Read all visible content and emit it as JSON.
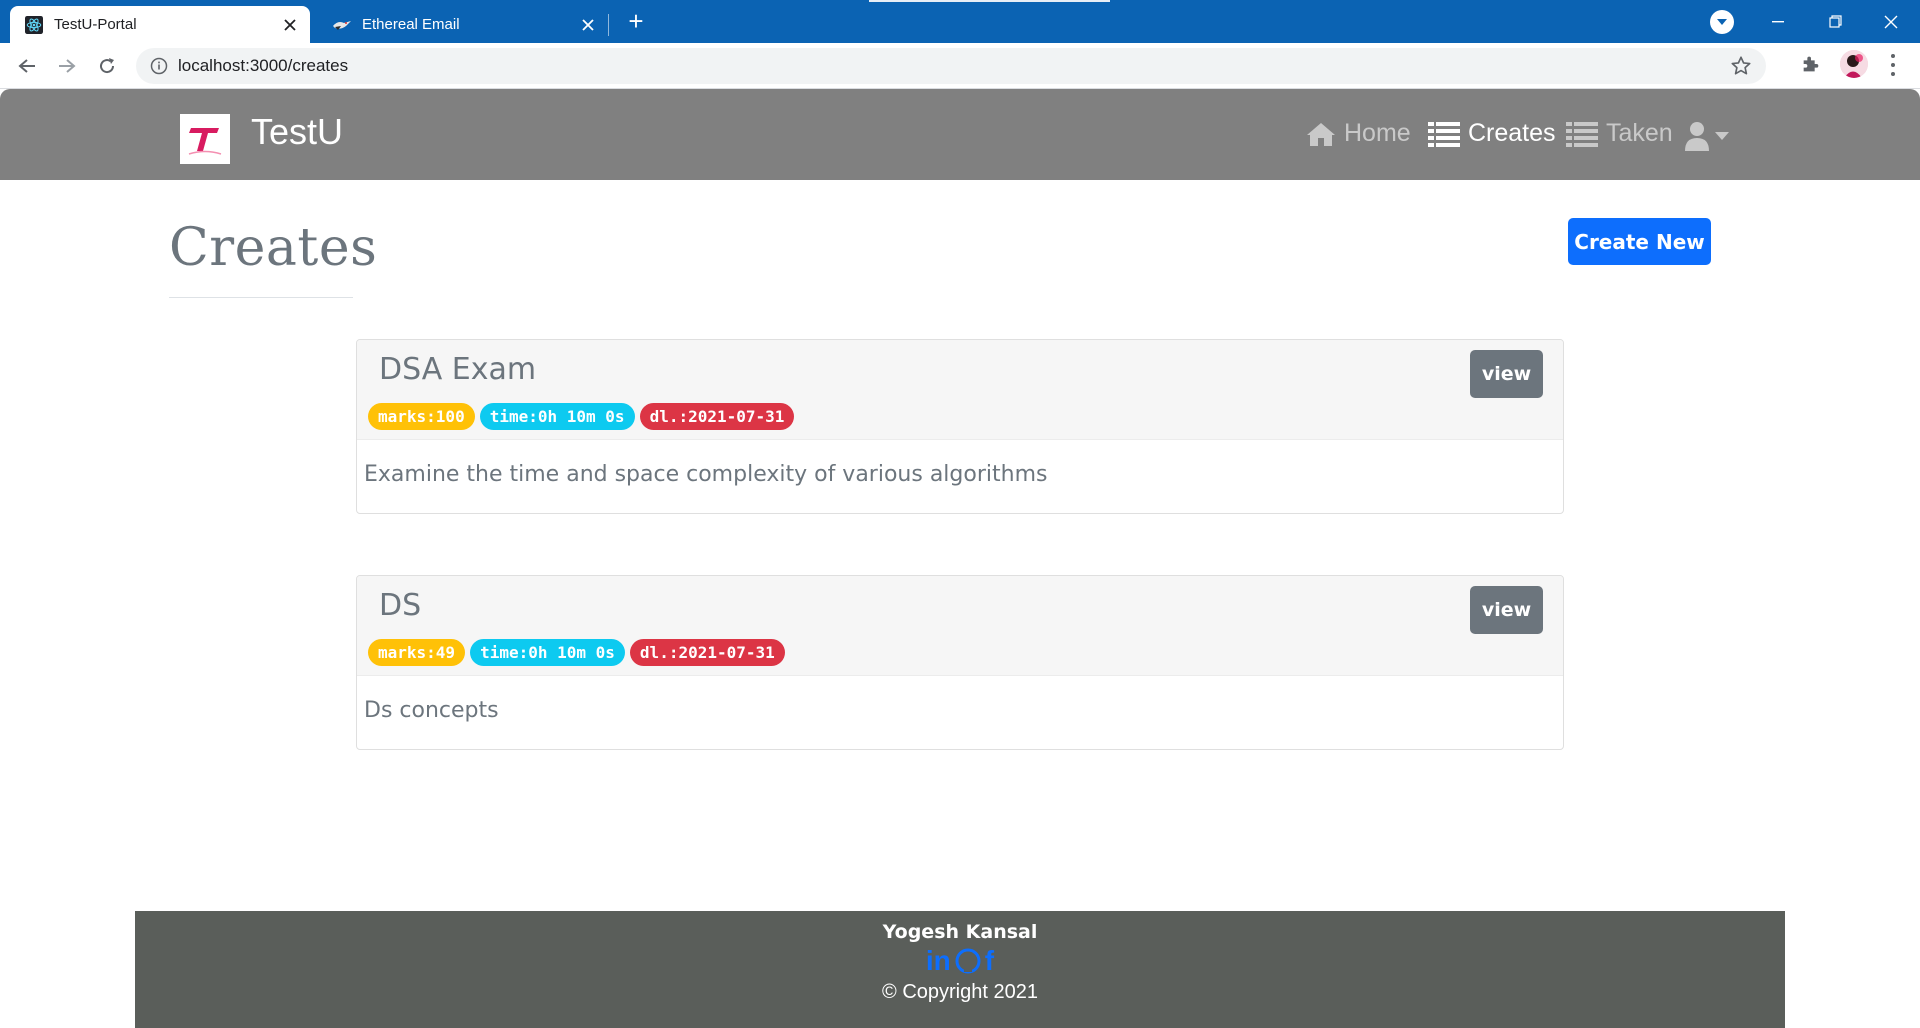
{
  "browser": {
    "tabs": [
      {
        "title": "TestU-Portal",
        "favicon": "react-icon",
        "active": true
      },
      {
        "title": "Ethereal Email",
        "favicon": "ethereal-bird-icon",
        "active": false
      }
    ],
    "url": "localhost:3000/creates"
  },
  "navbar": {
    "brand": "TestU",
    "links": {
      "home": "Home",
      "creates": "Creates",
      "taken": "Taken"
    },
    "active_link": "creates"
  },
  "page": {
    "title": "Creates",
    "create_button": "Create New"
  },
  "tests": [
    {
      "title": "DSA Exam",
      "marks": "marks:100",
      "time": "time:0h 10m 0s",
      "deadline": "dl.:2021-07-31",
      "description": "Examine the time and space complexity of various algorithms",
      "view_label": "view"
    },
    {
      "title": "DS",
      "marks": "marks:49",
      "time": "time:0h 10m 0s",
      "deadline": "dl.:2021-07-31",
      "description": "Ds concepts",
      "view_label": "view"
    }
  ],
  "footer": {
    "name": "Yogesh Kansal",
    "socials": [
      "linkedin-icon",
      "github-icon",
      "facebook-icon"
    ],
    "copyright": "© Copyright 2021"
  },
  "colors": {
    "chrome_blue": "#0b63b3",
    "navbar_gray": "#808080",
    "primary": "#0d6efd",
    "secondary": "#6c757d",
    "warning": "#ffc107",
    "info": "#0dcaf0",
    "danger": "#dc3545",
    "footer": "#5a5e5a"
  }
}
